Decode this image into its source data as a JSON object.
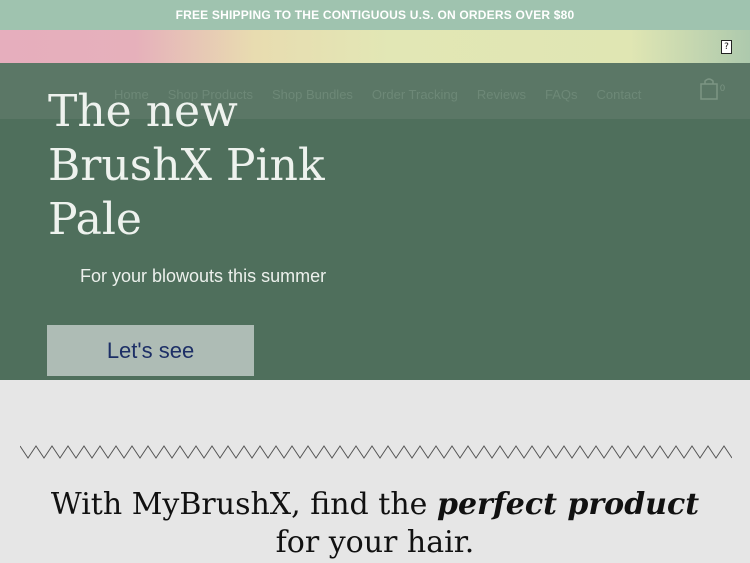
{
  "announcement": "FREE SHIPPING TO THE CONTIGUOUS U.S. ON ORDERS OVER $80",
  "top_bar": {
    "icon": "unknown-glyph-icon"
  },
  "nav": {
    "items": [
      "Home",
      "Shop Products",
      "Shop Bundles",
      "Order Tracking",
      "Reviews",
      "FAQs",
      "Contact"
    ],
    "cart_count": "0"
  },
  "hero": {
    "title": "The new BrushX Pink Pale",
    "subtitle": "For your blowouts this summer",
    "cta_label": "Let's see"
  },
  "tagline": {
    "part1": "With MyBrushX, find the ",
    "emphasis": "perfect product",
    "part2": "for your hair."
  },
  "colors": {
    "announcement_bg": "#9fc3af",
    "hero_bg": "#4f6f5c",
    "cta_bg": "#aebcb5",
    "cta_text": "#1d2f66"
  }
}
